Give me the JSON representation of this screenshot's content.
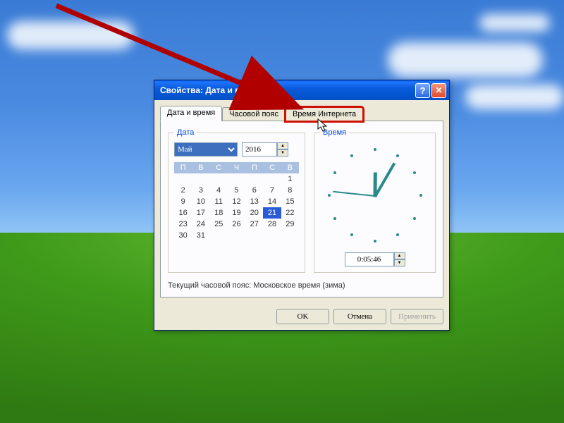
{
  "dialog": {
    "title": "Свойства: Дата и время",
    "tabs": [
      {
        "label": "Дата и время"
      },
      {
        "label": "Часовой пояс"
      },
      {
        "label": "Время Интернета"
      }
    ],
    "date_group": "Дата",
    "time_group": "Время",
    "month": "Май",
    "year": "2016",
    "weekdays": [
      "П",
      "В",
      "С",
      "Ч",
      "П",
      "С",
      "В"
    ],
    "calendar": [
      [
        "",
        "",
        "",
        "",
        "",
        "",
        "1"
      ],
      [
        "2",
        "3",
        "4",
        "5",
        "6",
        "7",
        "8"
      ],
      [
        "9",
        "10",
        "11",
        "12",
        "13",
        "14",
        "15"
      ],
      [
        "16",
        "17",
        "18",
        "19",
        "20",
        "21",
        "22"
      ],
      [
        "23",
        "24",
        "25",
        "26",
        "27",
        "28",
        "29"
      ],
      [
        "30",
        "31",
        "",
        "",
        "",
        "",
        ""
      ]
    ],
    "selected_day": "21",
    "time_value": "0:05:46",
    "timezone_text": "Текущий часовой пояс: Московское время (зима)",
    "buttons": {
      "ok": "OK",
      "cancel": "Отмена",
      "apply": "Применить"
    }
  }
}
